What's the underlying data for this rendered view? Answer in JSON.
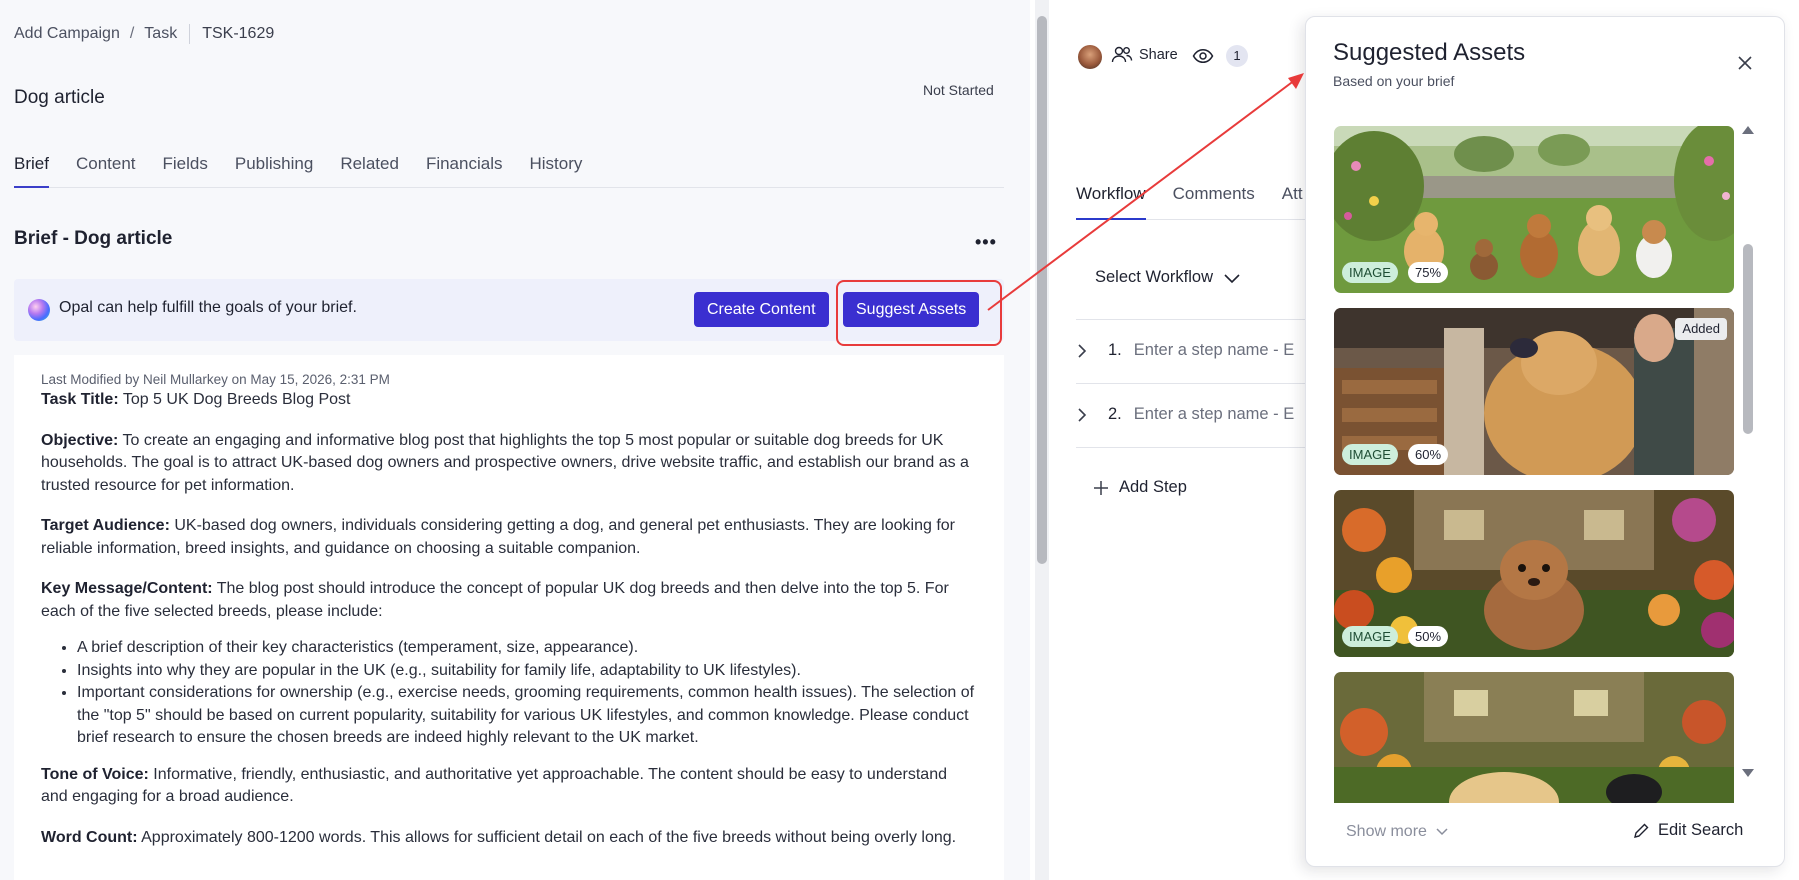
{
  "breadcrumb": {
    "items": [
      "Add Campaign",
      "Task"
    ],
    "task_id": "TSK-1629"
  },
  "task": {
    "title": "Dog article",
    "status": "Not Started"
  },
  "tabs": [
    "Brief",
    "Content",
    "Fields",
    "Publishing",
    "Related",
    "Financials",
    "History"
  ],
  "brief": {
    "section_title": "Brief - Dog article",
    "opal_text": "Opal can help fulfill the goals of your brief.",
    "create_content_label": "Create Content",
    "suggest_assets_label": "Suggest Assets",
    "last_modified": "Last Modified by Neil Mullarkey on May 15, 2026, 2:31 PM",
    "task_title_label": "Task Title:",
    "task_title_value": " Top 5 UK Dog Breeds Blog Post",
    "objective_label": "Objective:",
    "objective_value": " To create an engaging and informative blog post that highlights the top 5 most popular or suitable dog breeds for UK households. The goal is to attract UK-based dog owners and prospective owners, drive website traffic, and establish our brand as a trusted resource for pet information.",
    "audience_label": "Target Audience:",
    "audience_value": " UK-based dog owners, individuals considering getting a dog, and general pet enthusiasts. They are looking for reliable information, breed insights, and guidance on choosing a suitable companion.",
    "key_message_label": "Key Message/Content:",
    "key_message_value": " The blog post should introduce the concept of popular UK dog breeds and then delve into the top 5. For each of the five selected breeds, please include:",
    "bullets": [
      "A brief description of their key characteristics (temperament, size, appearance).",
      "Insights into why they are popular in the UK (e.g., suitability for family life, adaptability to UK lifestyles).",
      "Important considerations for ownership (e.g., exercise needs, grooming requirements, common health issues). The selection of the \"top 5\" should be based on current popularity, suitability for various UK lifestyles, and common knowledge. Please conduct brief research to ensure the chosen breeds are indeed highly relevant to the UK market."
    ],
    "tone_label": "Tone of Voice:",
    "tone_value": " Informative, friendly, enthusiastic, and authoritative yet approachable. The content should be easy to understand and engaging for a broad audience.",
    "word_count_label": "Word Count:",
    "word_count_value": " Approximately 800-1200 words. This allows for sufficient detail on each of the five breeds without being overly long."
  },
  "middle": {
    "share_label": "Share",
    "viewer_count": "1",
    "tabs": [
      "Workflow",
      "Comments",
      "Att"
    ],
    "select_workflow": "Select Workflow",
    "steps": [
      {
        "num": "1.",
        "placeholder": "Enter a step name - E"
      },
      {
        "num": "2.",
        "placeholder": "Enter a step name - E"
      }
    ],
    "add_step": "Add Step"
  },
  "panel": {
    "title": "Suggested Assets",
    "subtitle": "Based on your brief",
    "assets": [
      {
        "type": "IMAGE",
        "match": "75%",
        "added": ""
      },
      {
        "type": "IMAGE",
        "match": "60%",
        "added": "Added"
      },
      {
        "type": "IMAGE",
        "match": "50%",
        "added": ""
      },
      {
        "type": "",
        "match": "",
        "added": ""
      }
    ],
    "show_more": "Show more",
    "edit_search": "Edit Search"
  },
  "colors": {
    "primary": "#3a2fd0",
    "highlight": "#e83b3b",
    "type_badge": "#cdeedb"
  },
  "icons": [
    "share-people-icon",
    "eye-icon",
    "chevron-down-icon",
    "chevron-right-icon",
    "plus-icon",
    "close-icon",
    "pencil-icon",
    "ellipsis-icon"
  ]
}
